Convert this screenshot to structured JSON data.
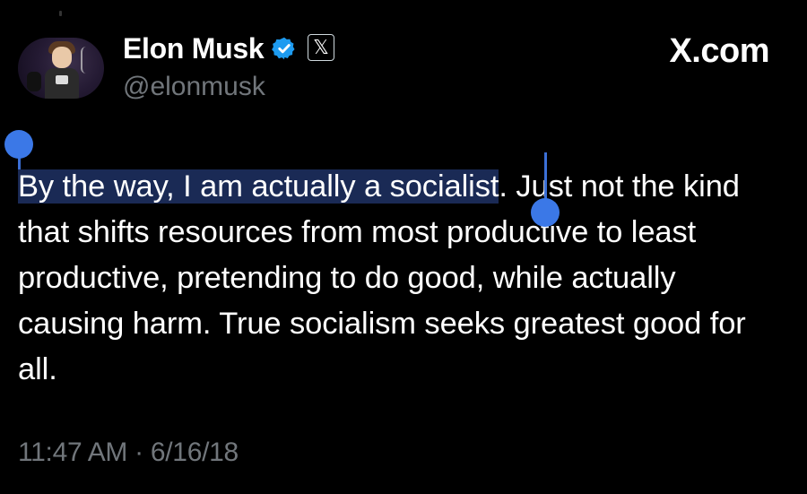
{
  "header": {
    "display_name": "Elon Musk",
    "handle": "@elonmusk",
    "brand": "X.com",
    "x_badge": "𝕏"
  },
  "tweet": {
    "selected_text": "By the way, I am actually a socialist",
    "rest_text": ". Just not the kind that shifts resources from most productive to least productive, pretending to do good, while actually causing harm. True socialism seeks greatest good for all."
  },
  "meta": {
    "time_date": "11:47 AM · 6/16/18"
  },
  "colors": {
    "background": "#000000",
    "verified": "#1d9bf0",
    "selection_handle": "#3b78e7",
    "selection_bg": "#1a2a55",
    "muted": "#71767b"
  },
  "icons": {
    "verified": "verified-badge-icon",
    "x_logo": "x-logo-icon",
    "selection_handles": "text-selection-handle"
  }
}
